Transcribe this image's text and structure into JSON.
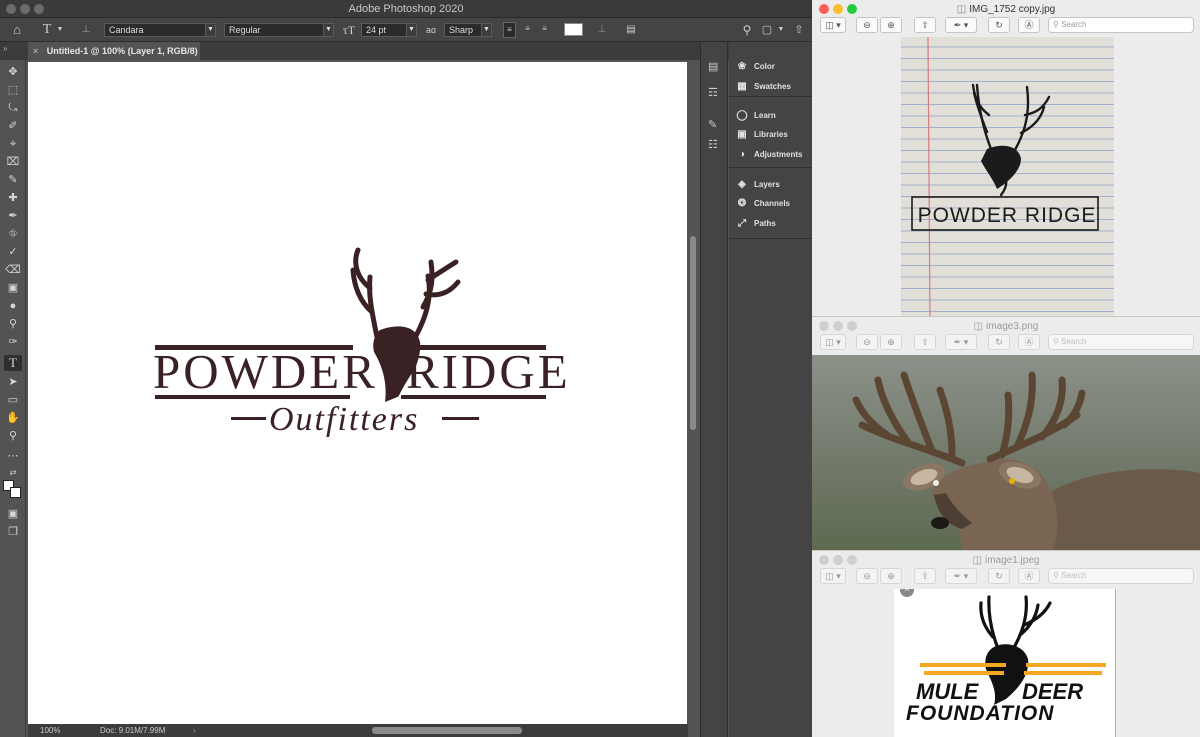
{
  "photoshop": {
    "app_title": "Adobe Photoshop 2020",
    "options_bar": {
      "tool_glyph": "T",
      "font_family": "Candara",
      "font_style": "Regular",
      "font_size": "24 pt",
      "aa_label": "aɑ",
      "anti_alias": "Sharp"
    },
    "document_tab": "Untitled-1 @ 100% (Layer 1, RGB/8) *",
    "status": {
      "zoom": "100%",
      "doc_size": "Doc: 9.01M/7.99M"
    },
    "panels": {
      "group1": [
        "Color",
        "Swatches"
      ],
      "group2": [
        "Learn",
        "Libraries",
        "Adjustments"
      ],
      "group3": [
        "Layers",
        "Channels",
        "Paths"
      ]
    },
    "logo": {
      "left_word": "POWDER",
      "right_word": "RIDGE",
      "tagline": "Outfitters",
      "color": "#3a2224"
    }
  },
  "previews": [
    {
      "title": "IMG_1752 copy.jpg",
      "active": true,
      "search_placeholder": "Search",
      "sketch_text": "POWDER RIDGE"
    },
    {
      "title": "image3.png",
      "active": false,
      "search_placeholder": "Search"
    },
    {
      "title": "image1.jpeg",
      "active": false,
      "search_placeholder": "Search",
      "logo_line1": "MULE",
      "logo_line1b": "DEER",
      "logo_line2": "FOUNDATION",
      "stripe_color": "#f5a623"
    }
  ],
  "colors": {
    "ps_bg": "#535353",
    "ps_dark": "#3c3c3c",
    "mac_red": "#fe5f57",
    "mac_yellow": "#febc2e",
    "mac_green": "#28c840"
  }
}
